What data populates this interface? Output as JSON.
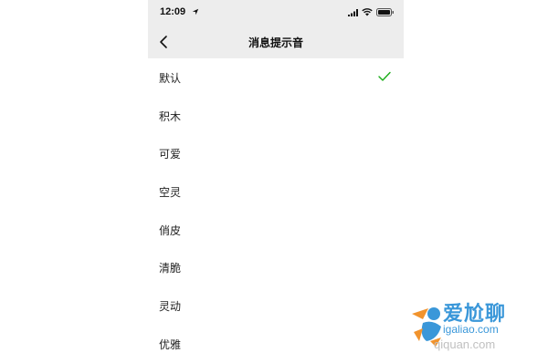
{
  "status_bar": {
    "time": "12:09",
    "icons": [
      "location-arrow-icon",
      "signal-icon",
      "wifi-icon",
      "battery-icon"
    ]
  },
  "nav": {
    "title": "消息提示音",
    "back_icon": "chevron-left-icon"
  },
  "list": {
    "items": [
      {
        "label": "默认",
        "selected": true
      },
      {
        "label": "积木",
        "selected": false
      },
      {
        "label": "可爱",
        "selected": false
      },
      {
        "label": "空灵",
        "selected": false
      },
      {
        "label": "俏皮",
        "selected": false
      },
      {
        "label": "清脆",
        "selected": false
      },
      {
        "label": "灵动",
        "selected": false
      },
      {
        "label": "优雅",
        "selected": false
      }
    ],
    "check_icon": "checkmark-icon"
  },
  "watermark": {
    "line1": "爱尬聊",
    "line2": "igaliao.com",
    "line3": "qiquan.com"
  },
  "colors": {
    "header_bg": "#ededed",
    "check": "#1aad19",
    "watermark": "#2a8fd6"
  }
}
